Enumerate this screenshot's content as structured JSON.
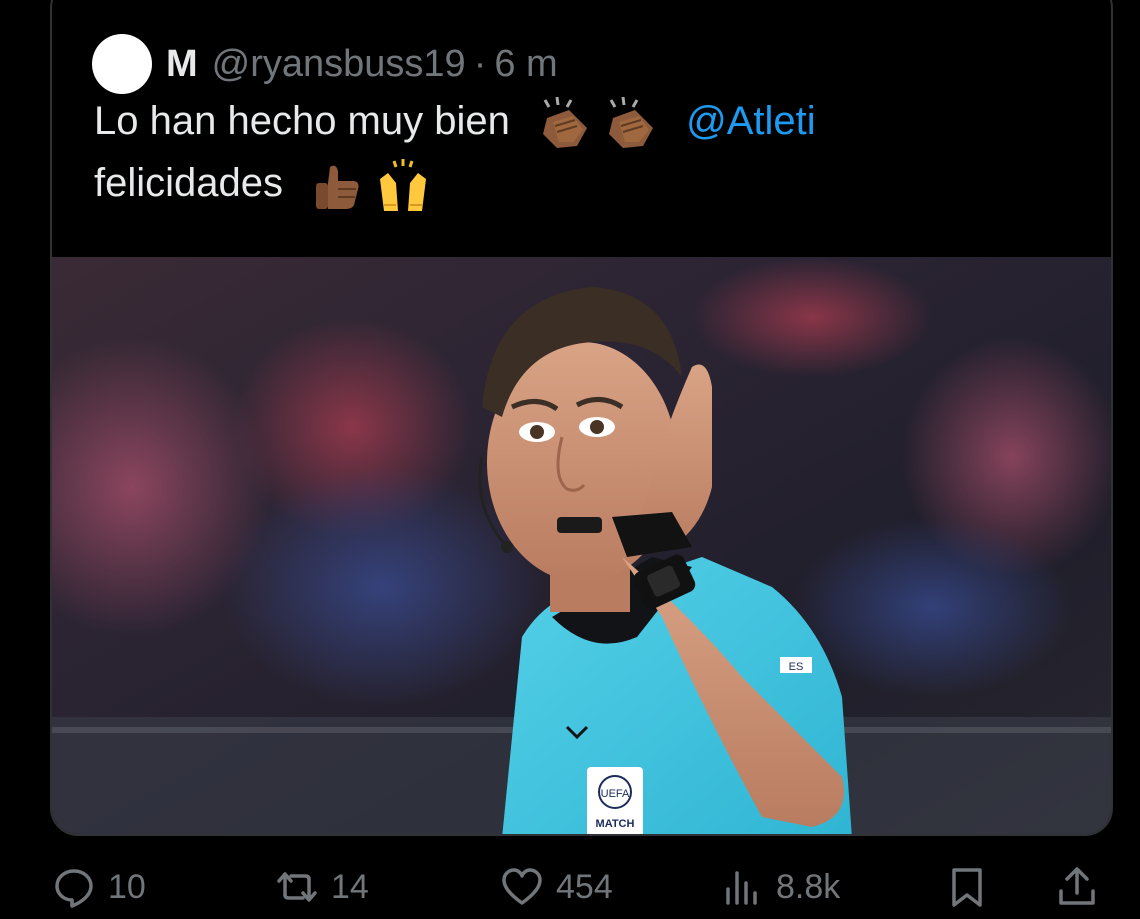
{
  "quoted_tweet": {
    "display_name": "M",
    "handle": "@ryansbuss19",
    "separator": "·",
    "time_ago": "6 m",
    "text_line1": "Lo han hecho muy bien",
    "mention": "@Atleti",
    "text_line2": "felicidades",
    "emoji_line1": [
      "clapping-hands-medium-dark",
      "clapping-hands-medium-dark"
    ],
    "emoji_line2": [
      "thumbs-up-medium-dark",
      "raising-hands"
    ]
  },
  "media": {
    "badge_text": "UEFA",
    "badge_sub": "MATCH",
    "sleeve_text": "ES"
  },
  "actions": {
    "replies": "10",
    "reposts": "14",
    "likes": "454",
    "views": "8.8k"
  },
  "colors": {
    "background": "#000000",
    "text": "#e7e9ea",
    "muted": "#71767b",
    "link": "#1d9bf0",
    "border": "#2f3336"
  }
}
